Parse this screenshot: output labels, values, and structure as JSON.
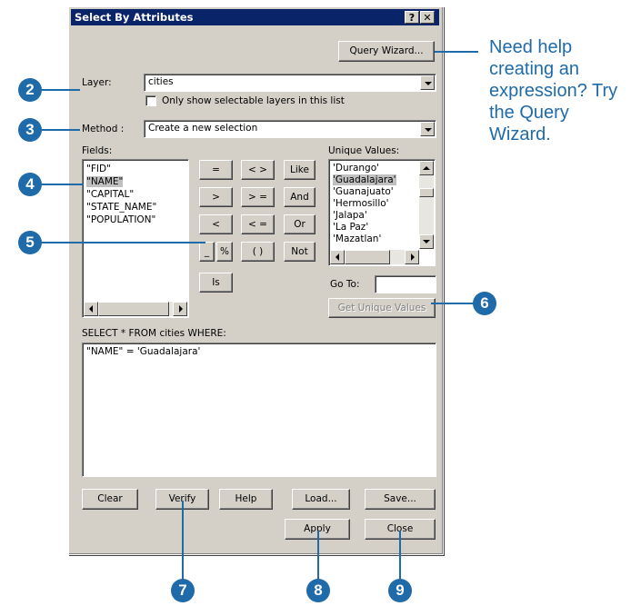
{
  "window": {
    "title": "Select By Attributes",
    "help_btn": "?",
    "close_btn": "✕"
  },
  "buttons": {
    "query_wizard": "Query Wizard...",
    "get_unique_values": "Get Unique Values",
    "clear": "Clear",
    "verify": "Verify",
    "help": "Help",
    "load": "Load...",
    "save": "Save...",
    "apply": "Apply",
    "close": "Close"
  },
  "layer": {
    "label": "Layer:",
    "value": "cities",
    "checkbox_label": "Only show selectable layers in this list"
  },
  "method": {
    "label": "Method :",
    "value": "Create a new selection"
  },
  "fields": {
    "label": "Fields:",
    "items": [
      "\"FID\"",
      "\"NAME\"",
      "\"CAPITAL\"",
      "\"STATE_NAME\"",
      "\"POPULATION\""
    ],
    "selected_index": 1
  },
  "operators": [
    "=",
    "< >",
    "Like",
    ">",
    "> =",
    "And",
    "<",
    "< =",
    "Or",
    "_",
    "%",
    "( )",
    "Not",
    "Is"
  ],
  "unique_values": {
    "label": "Unique Values:",
    "items": [
      "'Durango'",
      "'Guadalajara'",
      "'Guanajuato'",
      "'Hermosillo'",
      "'Jalapa'",
      "'La Paz'",
      "'Mazatlan'"
    ],
    "selected_index": 1
  },
  "goto": {
    "label": "Go To:",
    "value": ""
  },
  "sql": {
    "label": "SELECT * FROM cities WHERE:",
    "expression": "\"NAME\" = 'Guadalajara'"
  },
  "annotation": {
    "help_text": "Need help creating an expression? Try the Query Wizard.",
    "callouts": [
      "2",
      "3",
      "4",
      "5",
      "6",
      "7",
      "8",
      "9"
    ]
  },
  "colors": {
    "accent": "#1f6aa8",
    "titlebar": "#0a246a",
    "dialog": "#d4d0c8"
  }
}
